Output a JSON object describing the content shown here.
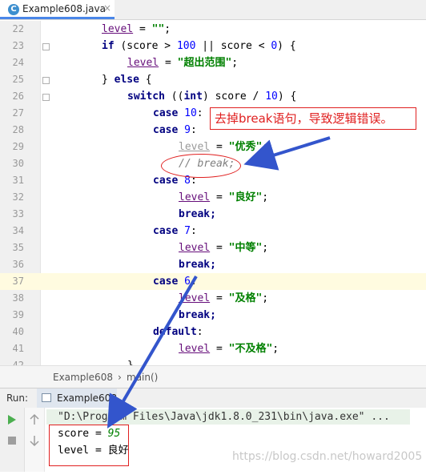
{
  "tab": {
    "icon": "C",
    "name": "Example608.java",
    "close": "×"
  },
  "editor": {
    "line_numbers": [
      "22",
      "23",
      "24",
      "25",
      "26",
      "27",
      "28",
      "29",
      "30",
      "31",
      "32",
      "33",
      "34",
      "35",
      "36",
      "37",
      "38",
      "39",
      "40",
      "41",
      "42"
    ]
  },
  "breadcrumb": {
    "class_name": "Example608",
    "separator": "›",
    "method": "main()"
  },
  "run": {
    "label": "Run:",
    "tab": "Example608"
  },
  "console": {
    "command": "\"D:\\Program Files\\Java\\jdk1.8.0_231\\bin\\java.exe\" ...",
    "score_label": "score = ",
    "score_value": "95",
    "level_line": "level = 良好"
  },
  "annotation": {
    "text": "去掉break语句，导致逻辑错误。"
  },
  "watermark": "https://blog.csdn.net/howard2005",
  "colors": {
    "annotation": "#e02020",
    "keyword": "#000080",
    "string": "#008000",
    "arrow": "#3355cc"
  }
}
